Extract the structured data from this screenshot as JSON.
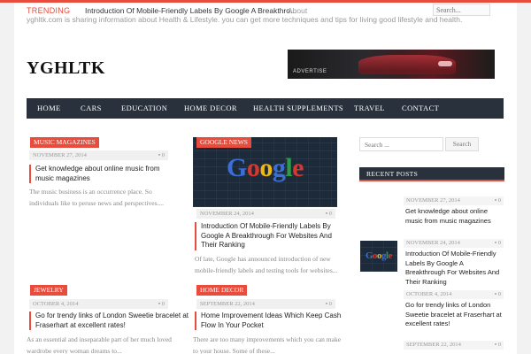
{
  "topbar": {
    "trending_label": "TRENDING",
    "trending_text": "Introduction Of Mobile-Friendly Labels By Google A Breakthro...",
    "about_label": "About",
    "about_text": "yghltk.com is sharing information about Health & Lifestyle. you can get more techniques and tips for living good lifestyle and health.",
    "search_placeholder": "Search..."
  },
  "header": {
    "logo": "YGHLTK",
    "ad_label": "ADVERTISE"
  },
  "nav": {
    "items": [
      "HOME",
      "CARS",
      "EDUCATION",
      "HOME DECOR",
      "HEALTH SUPPLEMENTS",
      "TRAVEL",
      "CONTACT"
    ]
  },
  "posts": [
    {
      "category": "MUSIC MAGAZINES",
      "date": "NOVEMBER 27, 2014",
      "comments": "0",
      "title": "Get knowledge about online music from music magazines",
      "excerpt": "The music business is an occurrence place. So individuals like to peruse news and perspectives...."
    },
    {
      "category": "GOOGLE NEWS",
      "date": "NOVEMBER 24, 2014",
      "comments": "0",
      "title": "Introduction Of Mobile-Friendly Labels By Google A Breakthrough For Websites And Their Ranking",
      "excerpt": "Of late, Google has announced introduction of new mobile-friendly labels and testing tools for websites...",
      "thumb_text": "Google"
    },
    {
      "category": "JEWELRY",
      "date": "OCTOBER 4, 2014",
      "comments": "0",
      "title": "Go for trendy links of London Sweetie bracelet at Fraserhart at excellent rates!",
      "excerpt": "As an essential and inseparable part of her much loved wardrobe every woman dreams to..."
    },
    {
      "category": "HOME DECOR",
      "date": "SEPTEMBER 22, 2014",
      "comments": "0",
      "title": "Home Improvement Ideas Which Keep Cash Flow In Your Pocket",
      "excerpt": "There are too many improvements which you can make to your house. Some of these..."
    }
  ],
  "sidebar": {
    "search_placeholder": "Search ...",
    "search_button": "Search",
    "recent_heading": "RECENT POSTS",
    "recent": [
      {
        "date": "NOVEMBER 27, 2014",
        "comments": "0",
        "title": "Get knowledge about online music from music magazines"
      },
      {
        "date": "NOVEMBER 24, 2014",
        "comments": "0",
        "title": "Introduction Of Mobile-Friendly Labels By Google A Breakthrough For Websites And Their Ranking"
      },
      {
        "date": "OCTOBER 4, 2014",
        "comments": "0",
        "title": "Go for trendy links of London Sweetie bracelet at Fraserhart at excellent rates!"
      },
      {
        "date": "SEPTEMBER 22, 2014",
        "comments": "0",
        "title": ""
      }
    ]
  },
  "colors": {
    "accent": "#e74c3c",
    "nav_bg": "#29323c"
  },
  "icons": {
    "comment": "comment-icon"
  }
}
